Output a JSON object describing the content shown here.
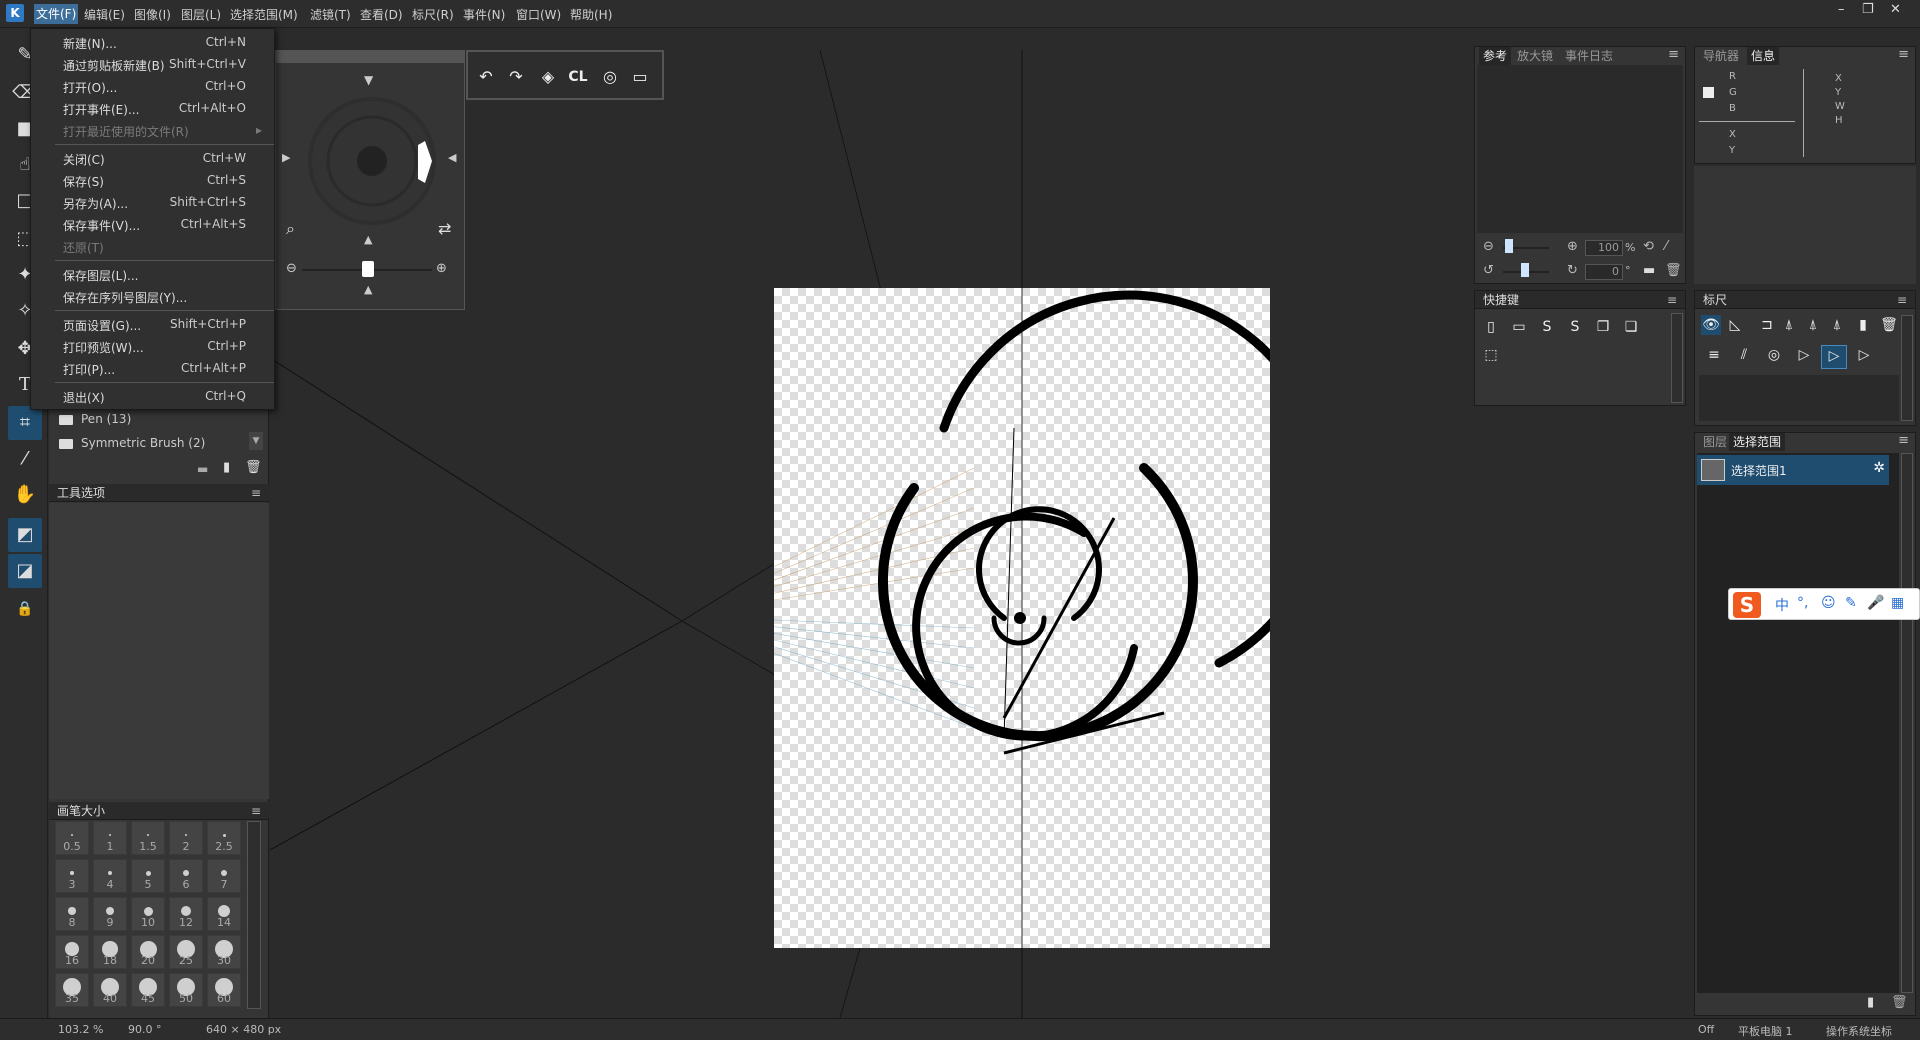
{
  "menubar": {
    "items": [
      "文件(F)",
      "编辑(E)",
      "图像(I)",
      "图层(L)",
      "选择范围(M)",
      "滤镜(T)",
      "查看(D)",
      "标尺(R)",
      "事件(N)",
      "窗口(W)",
      "帮助(H)"
    ],
    "window_controls": [
      "–",
      "❐",
      "✕"
    ]
  },
  "file_menu": {
    "items": [
      {
        "label": "新建(N)...",
        "shortcut": "Ctrl+N",
        "enabled": true
      },
      {
        "label": "通过剪贴板新建(B)",
        "shortcut": "Shift+Ctrl+V",
        "enabled": true
      },
      {
        "label": "打开(O)...",
        "shortcut": "Ctrl+O",
        "enabled": true
      },
      {
        "label": "打开事件(E)...",
        "shortcut": "Ctrl+Alt+O",
        "enabled": true
      },
      {
        "label": "打开最近使用的文件(R)",
        "shortcut": "▸",
        "enabled": false
      },
      {
        "label": "关闭(C)",
        "shortcut": "Ctrl+W",
        "enabled": true
      },
      {
        "label": "保存(S)",
        "shortcut": "Ctrl+S",
        "enabled": true
      },
      {
        "label": "另存为(A)...",
        "shortcut": "Shift+Ctrl+S",
        "enabled": true
      },
      {
        "label": "保存事件(V)...",
        "shortcut": "Ctrl+Alt+S",
        "enabled": true
      },
      {
        "label": "还原(T)",
        "shortcut": "",
        "enabled": false
      },
      {
        "label": "保存图层(L)...",
        "shortcut": "",
        "enabled": true
      },
      {
        "label": "保存在序列号图层(Y)...",
        "shortcut": "",
        "enabled": true
      },
      {
        "label": "页面设置(G)...",
        "shortcut": "Shift+Ctrl+P",
        "enabled": true
      },
      {
        "label": "打印预览(W)...",
        "shortcut": "Ctrl+P",
        "enabled": true
      },
      {
        "label": "打印(P)...",
        "shortcut": "Ctrl+Alt+P",
        "enabled": true
      },
      {
        "label": "退出(X)",
        "shortcut": "Ctrl+Q",
        "enabled": true
      }
    ]
  },
  "brush_panel": {
    "folders": [
      "Pen (13)",
      "Symmetric Brush (2)"
    ]
  },
  "tool_options": {
    "title": "工具选项"
  },
  "brush_size": {
    "title": "画笔大小",
    "sizes": [
      "0.5",
      "1",
      "1.5",
      "2",
      "2.5",
      "3",
      "4",
      "5",
      "6",
      "7",
      "8",
      "9",
      "10",
      "12",
      "14",
      "16",
      "18",
      "20",
      "25",
      "30",
      "35",
      "40",
      "45",
      "50",
      "60"
    ]
  },
  "history_toolbar": {
    "icons": [
      "↶",
      "↷",
      "◈",
      "CL",
      "◎",
      "▭"
    ]
  },
  "ref_panel": {
    "tabs": [
      "参考",
      "放大镜",
      "事件日志"
    ],
    "zoom": "100",
    "zoom_unit": "%",
    "rotate": "0",
    "rotate_unit": "°"
  },
  "nav_panel": {
    "tabs": [
      "导航器",
      "信息"
    ],
    "labels_left": [
      "R",
      "G",
      "B",
      "X",
      "Y"
    ],
    "labels_right": [
      "X",
      "Y",
      "W",
      "H"
    ]
  },
  "shortcuts_panel": {
    "title": "快捷键"
  },
  "ruler_panel": {
    "title": "标尺"
  },
  "layers_panel": {
    "tabs": [
      "图层",
      "选择范围"
    ],
    "items": [
      {
        "name": "选择范围1"
      }
    ]
  },
  "ime": {
    "icons": [
      "中",
      "°,",
      "☺",
      "✎",
      "🎤",
      "▦"
    ]
  },
  "status": {
    "zoom": "103.2 %",
    "rotation": "90.0 °",
    "size": "640 × 480 px",
    "off": "Off",
    "tablet": "平板电脑 1",
    "coord": "操作系统坐标"
  }
}
